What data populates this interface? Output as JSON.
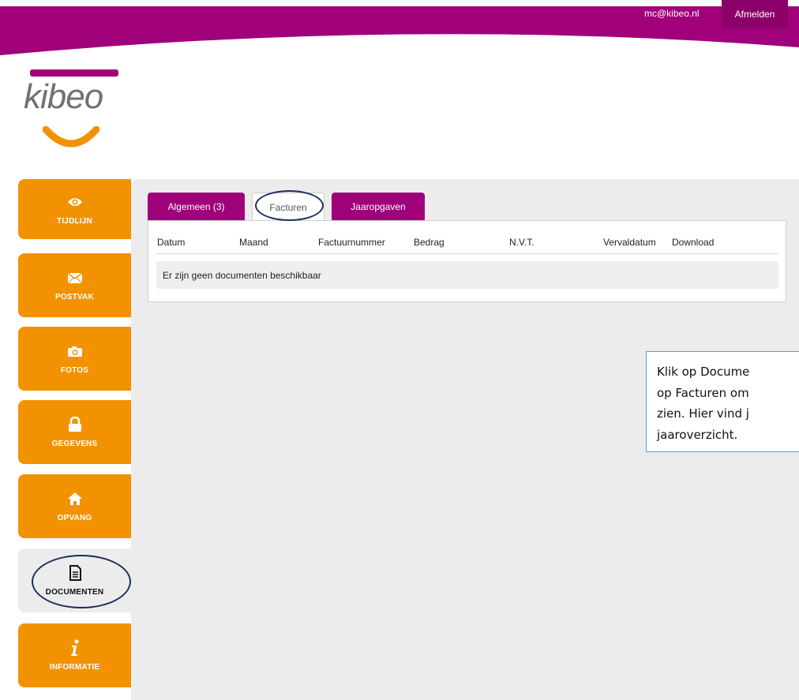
{
  "header": {
    "user_email": "mc@kibeo.nl",
    "logout_label": "Afmelden",
    "brand_color": "#a0007a"
  },
  "logo": {
    "text": "kibeo"
  },
  "sidebar": {
    "accent_color": "#f29200",
    "items": [
      {
        "label": "TIJDLIJN",
        "icon": "eye-icon"
      },
      {
        "label": "POSTVAK",
        "icon": "envelope-icon"
      },
      {
        "label": "FOTOS",
        "icon": "camera-icon"
      },
      {
        "label": "GEGEVENS",
        "icon": "lock-icon"
      },
      {
        "label": "OPVANG",
        "icon": "home-icon"
      },
      {
        "label": "DOCUMENTEN",
        "icon": "document-icon",
        "active": true
      },
      {
        "label": "INFORMATIE",
        "icon": "info-icon"
      }
    ]
  },
  "tabs": [
    {
      "label": "Algemeen (3)"
    },
    {
      "label": "Facturen",
      "active": true
    },
    {
      "label": "Jaaropgaven"
    }
  ],
  "table": {
    "columns": [
      "Datum",
      "Maand",
      "Factuurnummer",
      "Bedrag",
      "N.V.T.",
      "Vervaldatum",
      "Download"
    ],
    "empty_message": "Er zijn geen documenten beschikbaar"
  },
  "callout": {
    "lines": [
      "Klik op Docume",
      "op Facturen om",
      "zien. Hier vind j",
      "jaaroverzicht."
    ]
  }
}
